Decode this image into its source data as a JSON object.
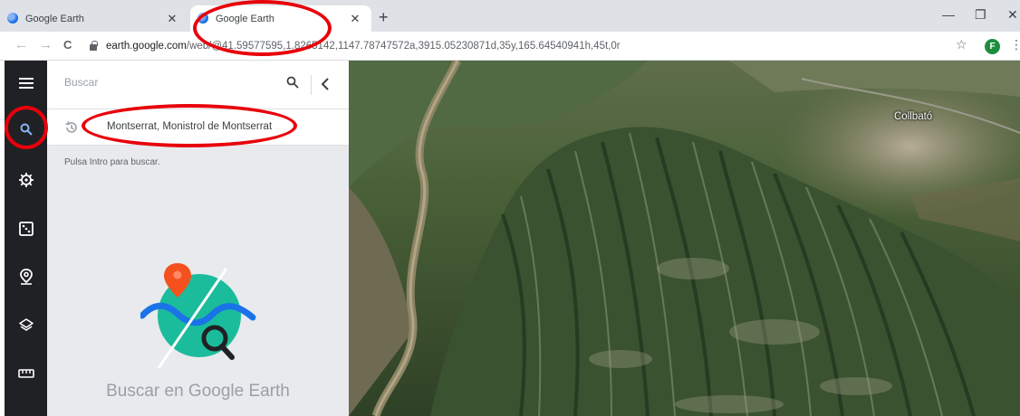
{
  "browser": {
    "tabs": [
      {
        "title": "Google Earth",
        "close": "✕"
      },
      {
        "title": "Google Earth",
        "close": "✕"
      }
    ],
    "new_tab": "+",
    "window_controls": {
      "minimize": "—",
      "restore": "❐",
      "close": "✕"
    },
    "nav": {
      "back": "←",
      "forward": "→",
      "reload": "C"
    },
    "url": {
      "host": "earth.google.com",
      "path": "/web/@41.59577595,1.8265142,1147.78747572a,3915.05230871d,35y,165.64540941h,45t,0r"
    },
    "bookmark_star": "☆",
    "profile_initial": "F",
    "menu": "⋮"
  },
  "rail": {
    "items": [
      {
        "name": "menu-icon"
      },
      {
        "name": "search-icon",
        "active": true
      },
      {
        "name": "voyager-icon"
      },
      {
        "name": "feeling-lucky-icon"
      },
      {
        "name": "projects-icon"
      },
      {
        "name": "map-style-icon"
      },
      {
        "name": "measure-icon"
      }
    ]
  },
  "search_panel": {
    "placeholder": "Buscar",
    "suggestion": "Montserrat, Monistrol de Montserrat",
    "hint": "Pulsa Intro para buscar.",
    "caption": "Buscar en Google Earth"
  },
  "map": {
    "place_label": "Collbató"
  },
  "colors": {
    "rail_bg": "#202124",
    "panel_bg": "#e8eaed",
    "annotation": "#e8000b",
    "illustration_teal": "#1bbc9b",
    "pin": "#f4511e",
    "wave": "#1a73e8"
  }
}
